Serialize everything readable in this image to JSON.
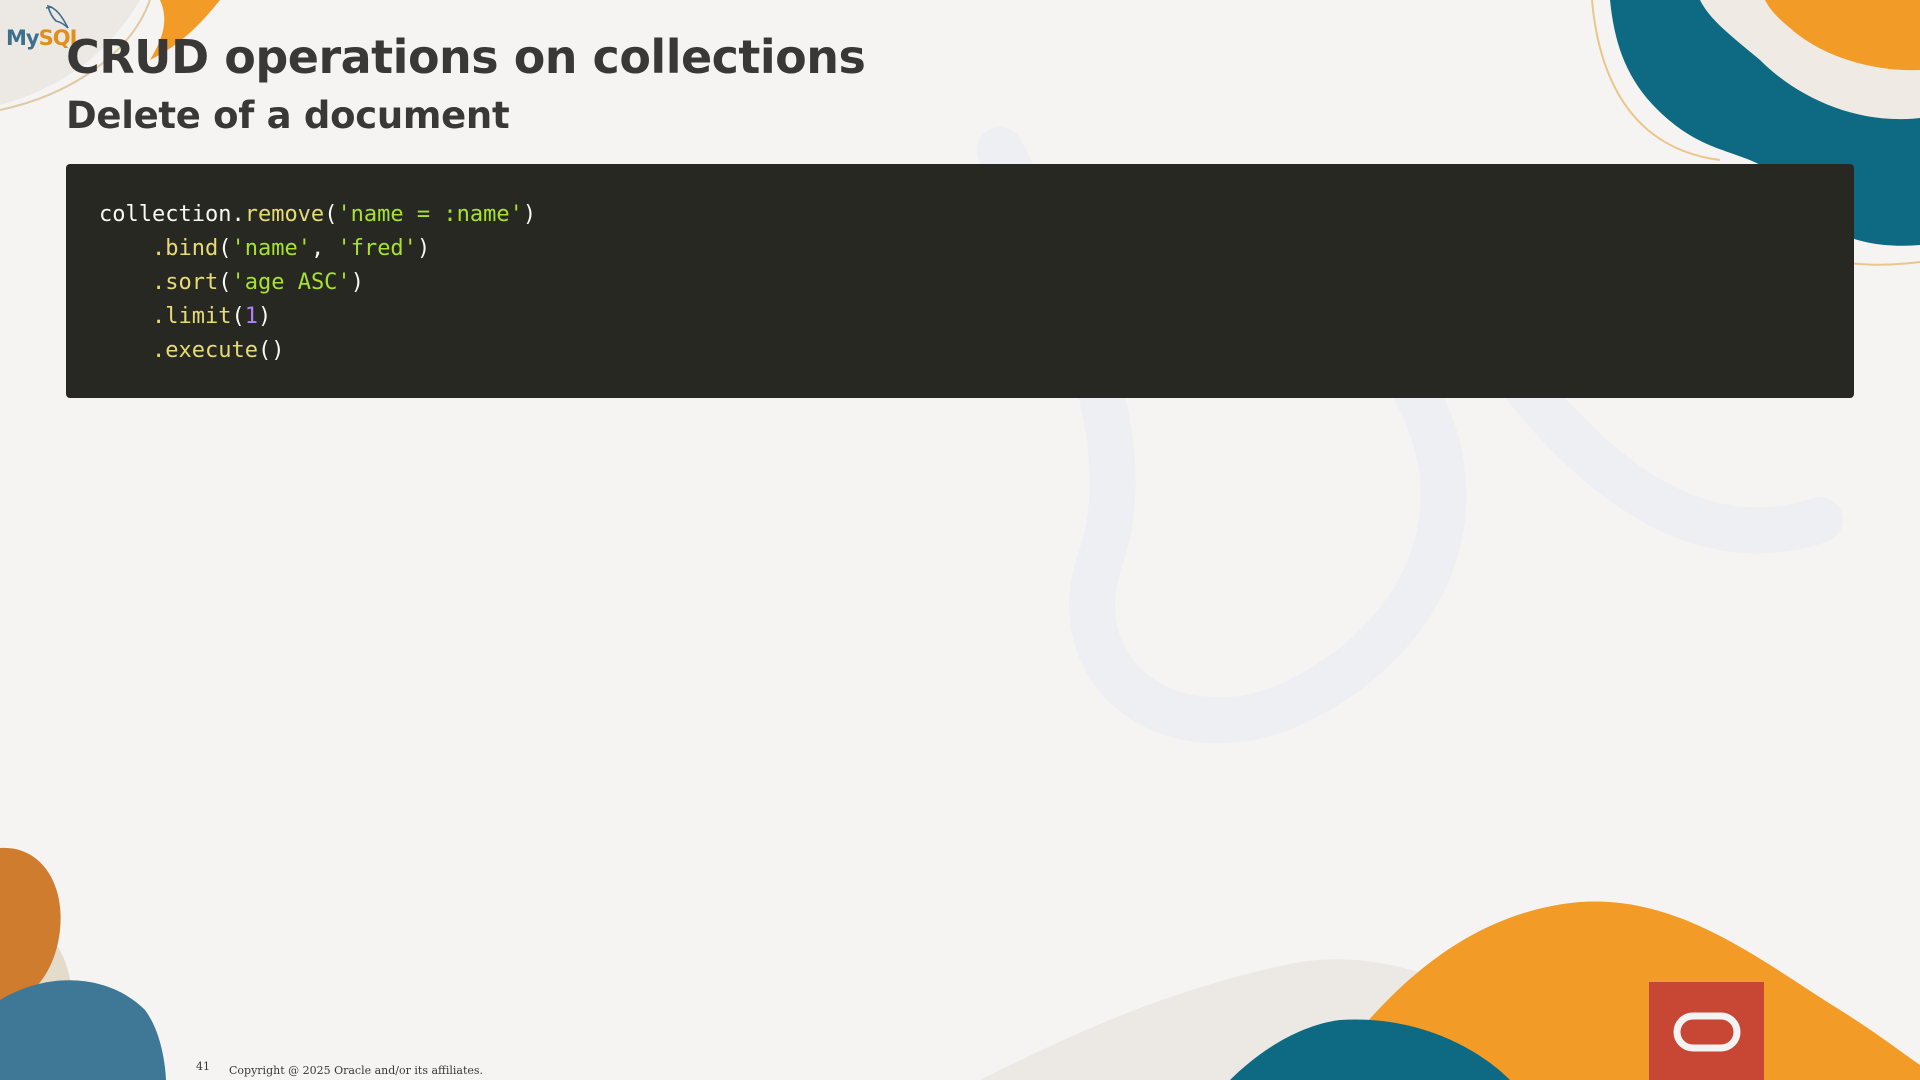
{
  "slide": {
    "title": "CRUD operations on collections",
    "subtitle": "Delete of a document",
    "page_number": "41",
    "copyright": "Copyright @ 2025 Oracle and/or its affiliates."
  },
  "logo": {
    "part1": "My",
    "part2": "SQL"
  },
  "code": {
    "line1": {
      "obj": "collection",
      "dot": ".",
      "method": "remove",
      "open": "(",
      "arg": "'name = :name'",
      "close": ")"
    },
    "line2": {
      "method": ".bind",
      "open": "(",
      "arg1": "'name'",
      "sep": ", ",
      "arg2": "'fred'",
      "close": ")"
    },
    "line3": {
      "method": ".sort",
      "open": "(",
      "arg": "'age ASC'",
      "close": ")"
    },
    "line4": {
      "method": ".limit",
      "open": "(",
      "arg": "1",
      "close": ")"
    },
    "line5": {
      "method": ".execute",
      "parens": "()"
    }
  },
  "colors": {
    "background": "#f6f4f3",
    "code_bg": "#272822",
    "title": "#3a3836",
    "accent_orange": "#f29b26",
    "accent_teal": "#0e6982",
    "accent_blue": "#3e7896",
    "oracle_red": "#c74634"
  }
}
